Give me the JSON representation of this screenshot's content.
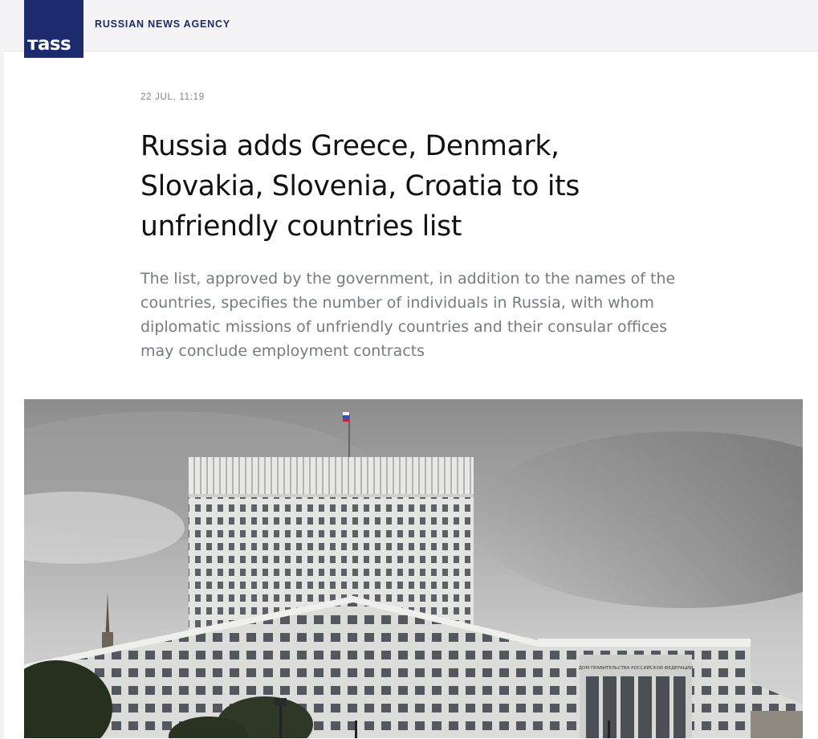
{
  "header": {
    "logo_text": "тass",
    "agency_name": "RUSSIAN NEWS AGENCY"
  },
  "article": {
    "date": "22 JUL, 11:19",
    "title": "Russia adds Greece, Denmark, Slovakia, Slovenia, Croatia to its unfriendly countries list",
    "lead": "The list, approved by the government, in addition to the names of the countries, specifies the number of individuals in Russia, with whom diplomatic missions of unfriendly countries and their consular offices may conclude employment contracts",
    "photo_sign": "ДОМ ПРАВИТЕЛЬСТВА РОССИЙСКОЙ ФЕДЕРАЦИИ"
  },
  "colors": {
    "brand": "#1c2a6e",
    "title": "#111111",
    "lead": "#767b82",
    "date": "#7e848c"
  }
}
